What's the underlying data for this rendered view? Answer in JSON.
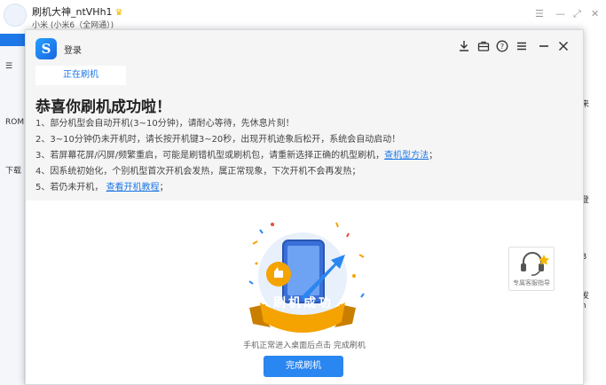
{
  "background": {
    "username": "刷机大神_ntVHh1",
    "device": "小米 (小米6（全网通）)",
    "window_controls": [
      "☰",
      "—",
      "⤢",
      "✕"
    ],
    "sidebar_labels": [
      "ROM",
      "下载"
    ],
    "right_labels": [
      "来",
      "登",
      "B",
      "发",
      "h"
    ]
  },
  "dialog": {
    "login_label": "登录",
    "icons": [
      "download-icon",
      "toolbox-icon",
      "help-icon",
      "menu-icon",
      "minimize-icon",
      "close-icon"
    ],
    "tab_label": "正在刷机",
    "title": "恭喜你刷机成功啦！",
    "lines": [
      "1、部分机型会自动开机(3~10分钟)，请耐心等待，先休息片刻！",
      "2、3~10分钟仍未开机时，请长按开机键3~20秒，出现开机迹象后松开，系统会自动启动！",
      "3、若屏幕花屏/闪屏/频繁重启，可能是刷错机型或刷机包，请重新选择正确的机型刷机，",
      "4、因系统初始化，个别机型首次开机会发热，属正常现象，下次开机不会再发热；",
      "5、若仍未开机，"
    ],
    "link_check_model": "查机型方法",
    "link_check_model_tail": "；",
    "link_boot_guide": "查看开机教程",
    "link_boot_guide_tail": "；",
    "badge_text": "刷机成功",
    "caption": "手机正常进入桌面后点击 完成刷机",
    "done_button": "完成刷机",
    "support_label": "专属客服指导"
  },
  "colors": {
    "accent": "#1f78e8",
    "button": "#2a86f1",
    "ribbon": "#f5a300",
    "panel_bg": "#f5f5f5"
  }
}
